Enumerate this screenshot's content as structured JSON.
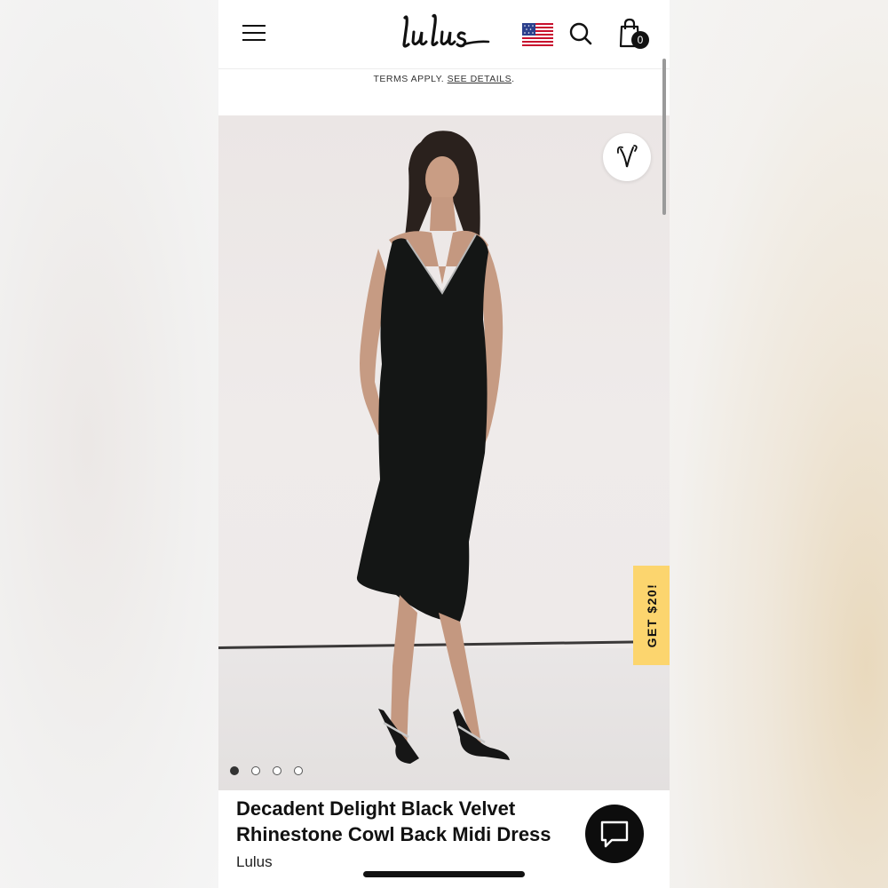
{
  "header": {
    "menu_icon": "hamburger-menu-icon",
    "logo_text": "Lulus",
    "flag_icon": "us-flag-icon",
    "search_icon": "search-icon",
    "cart_icon": "shopping-bag-icon",
    "cart_count": "0"
  },
  "promo": {
    "text": "TERMS APPLY.",
    "link_text": "SEE DETAILS",
    "suffix": "."
  },
  "gallery": {
    "wishlist_icon": "heart-icon",
    "image_count": 4,
    "active_index": 0
  },
  "offer_tab": {
    "label": "GET $20!"
  },
  "product": {
    "title_line1": "Decadent Delight Black Velvet",
    "title_line2": "Rhinestone Cowl Back Midi Dress",
    "brand": "Lulus"
  },
  "chat": {
    "icon": "chat-bubble-icon"
  },
  "colors": {
    "offer_tab": "#fcd56e",
    "chat_button": "#0d0d0d"
  }
}
